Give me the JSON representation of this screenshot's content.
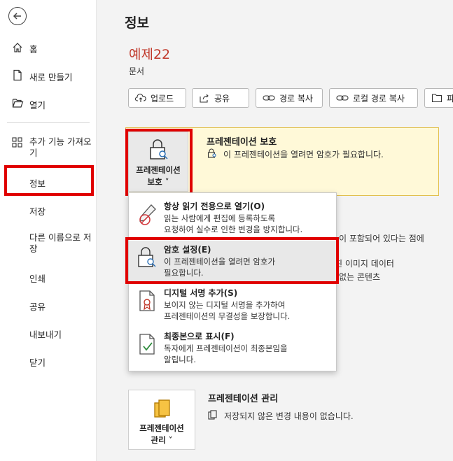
{
  "sidebar": {
    "back_label": "",
    "items": [
      {
        "label": "홈",
        "icon": "home-icon"
      },
      {
        "label": "새로 만들기",
        "icon": "new-document-icon"
      },
      {
        "label": "열기",
        "icon": "folder-open-icon"
      },
      {
        "label": "추가 기능 가져오기",
        "icon": "add-ins-grid-icon"
      },
      {
        "label": "정보"
      },
      {
        "label": "저장"
      },
      {
        "label": "다른 이름으로 저장"
      },
      {
        "label": "인쇄"
      },
      {
        "label": "공유"
      },
      {
        "label": "내보내기"
      },
      {
        "label": "닫기"
      }
    ]
  },
  "page": {
    "title": "정보",
    "doc_name": "예제22",
    "doc_type": "문서"
  },
  "toolbar": {
    "upload": "업로드",
    "share": "공유",
    "copy_path": "경로 복사",
    "copy_local_path": "로컬 경로 복사",
    "open_location": "파"
  },
  "protect": {
    "button_line1": "프레젠테이션",
    "button_line2": "보호 ˅",
    "title": "프레젠테이션 보호",
    "desc": "이 프레젠테이션을 열려면 암호가 필요합니다."
  },
  "background_text": {
    "line1": "이 포함되어 있다는 점에",
    "line2": "진 이미지 데이터",
    "line3": "없는 콘텐츠"
  },
  "dropdown": {
    "items": [
      {
        "title": "항상 읽기 전용으로 열기(O)",
        "desc1": "읽는 사람에게 편집에 등록하도록",
        "desc2": "요청하여 실수로 인한 변경을 방지합니다."
      },
      {
        "title": "암호 설정(E)",
        "desc1": "이 프레젠테이션을 열려면 암호가",
        "desc2": "필요합니다."
      },
      {
        "title": "디지털 서명 추가(S)",
        "desc1": "보이지 않는 디지털 서명을 추가하여",
        "desc2": "프레젠테이션의 무결성을 보장합니다."
      },
      {
        "title": "최종본으로 표시(F)",
        "desc1": "독자에게 프레젠테이션이 최종본임을",
        "desc2": "알립니다."
      }
    ]
  },
  "manage": {
    "button_line1": "프레젠테이션",
    "button_line2": "관리 ˅",
    "title": "프레젠테이션 관리",
    "desc": "저장되지 않은 변경 내용이 없습니다."
  },
  "colors": {
    "highlight_red": "#e00000",
    "doc_name_red": "#c0392b",
    "protect_panel_bg": "#fff9d8"
  }
}
